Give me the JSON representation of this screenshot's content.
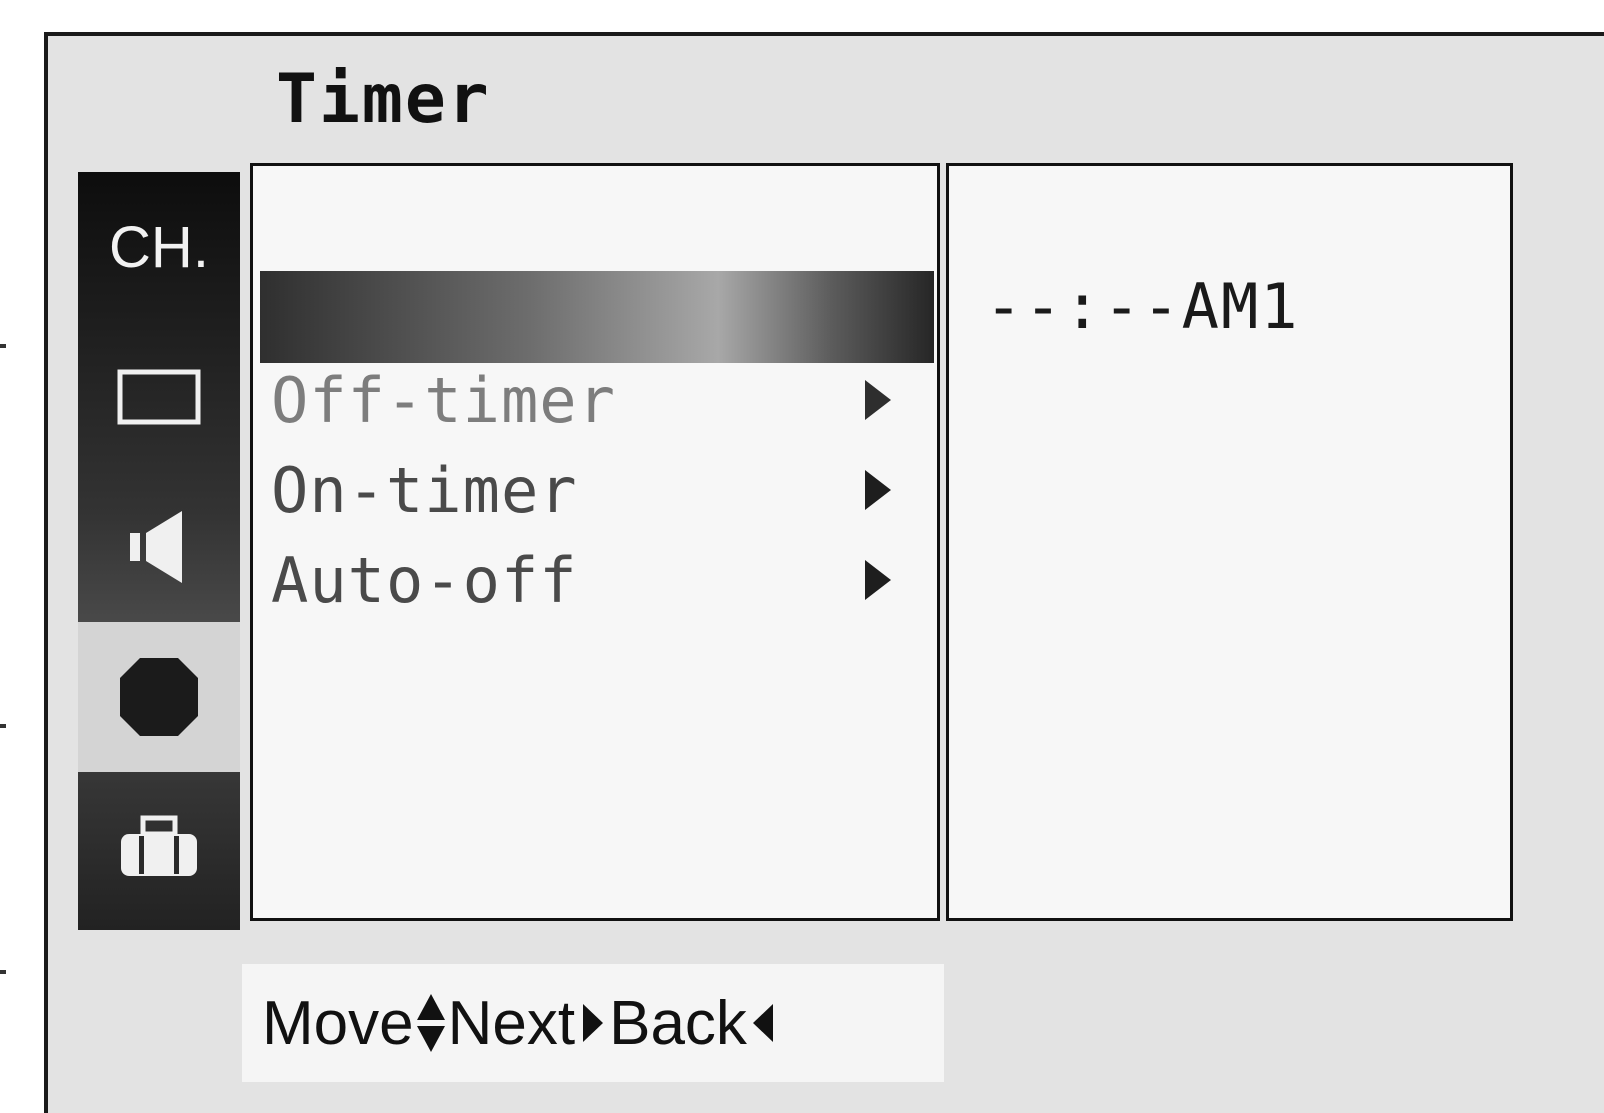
{
  "osd": {
    "title": "Timer",
    "sidebar": {
      "items": [
        {
          "name": "channel",
          "label": "CH.",
          "selected": false
        },
        {
          "name": "picture",
          "icon": "picture-icon",
          "selected": false
        },
        {
          "name": "sound",
          "icon": "speaker-icon",
          "selected": false
        },
        {
          "name": "time",
          "icon": "time-icon",
          "selected": true
        },
        {
          "name": "special",
          "icon": "toolbox-icon",
          "selected": false
        }
      ]
    },
    "menu": {
      "items": [
        {
          "label": "",
          "highlighted": true
        },
        {
          "label": "Off-timer",
          "arrow": "arrow-right-icon",
          "dimmed": true
        },
        {
          "label": "On-timer",
          "arrow": "arrow-right-icon"
        },
        {
          "label": "Auto-off",
          "arrow": "arrow-right-icon"
        }
      ]
    },
    "value_panel": {
      "time_value": "--:--AM1"
    },
    "help": {
      "move_label": "Move",
      "next_label": "Next",
      "back_label": "Back"
    }
  },
  "colors": {
    "frame": "#1a1a1a",
    "osd_background": "#e3e3e3",
    "panel_background": "#f7f7f7",
    "sidebar_dark": "#0d0d0d",
    "sidebar_selected": "#d4d4d4",
    "menu_text": "#4a4a4a"
  }
}
